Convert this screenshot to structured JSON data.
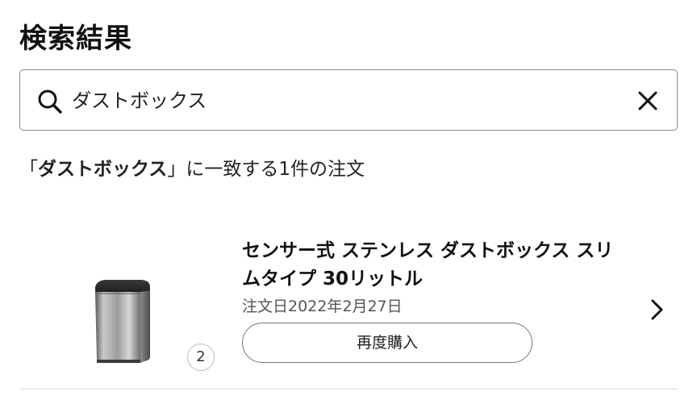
{
  "header": {
    "title": "検索結果"
  },
  "search": {
    "value": "ダストボックス",
    "icon": "search-icon",
    "clear_icon": "close-icon"
  },
  "summary": {
    "open_quote": "「",
    "keyword": "ダストボックス",
    "rest": "」に一致する1件の注文"
  },
  "orders": [
    {
      "title": "センサー式 ステンレス ダストボックス スリムタイプ 30リットル",
      "order_date": "注文日2022年2月27日",
      "quantity": "2",
      "rebuy_label": "再度購入",
      "icon": "chevron-right-icon"
    }
  ]
}
